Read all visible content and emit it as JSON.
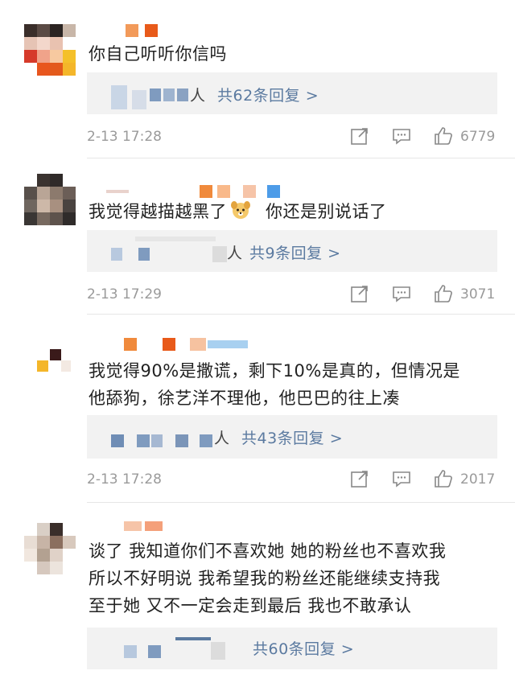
{
  "comments": [
    {
      "text": "你自己听听你信吗",
      "reply_link": "共62条回复 >",
      "reply_prefix": "人",
      "time": "2-13 17:28",
      "likes": "6779"
    },
    {
      "text_before": "我觉得越描越黑了",
      "text_after": "你还是别说话了",
      "reply_link": "共9条回复 >",
      "reply_prefix": "人",
      "time": "2-13 17:29",
      "likes": "3071"
    },
    {
      "line1": "我觉得90%是撒谎，剩下10%是真的，但情况是",
      "line2": "他舔狗，徐艺洋不理他，他巴巴的往上凑",
      "reply_link": "共43条回复 >",
      "reply_prefix": "人",
      "time": "2-13 17:28",
      "likes": "2017"
    },
    {
      "line1": "谈了 我知道你们不喜欢她 她的粉丝也不喜欢我",
      "line2": "所以不好明说 我希望我的粉丝还能继续支持我",
      "line3": "至于她 又不一定会走到最后 我也不敢承认",
      "reply_link": "共60条回复 >"
    }
  ],
  "icons": {
    "share": "share-icon",
    "comment": "comment-icon",
    "like": "thumbs-up-icon"
  },
  "colors": {
    "link": "#5b7aa0",
    "meta": "#9a9a9a",
    "reply_bg": "#f2f2f2"
  }
}
